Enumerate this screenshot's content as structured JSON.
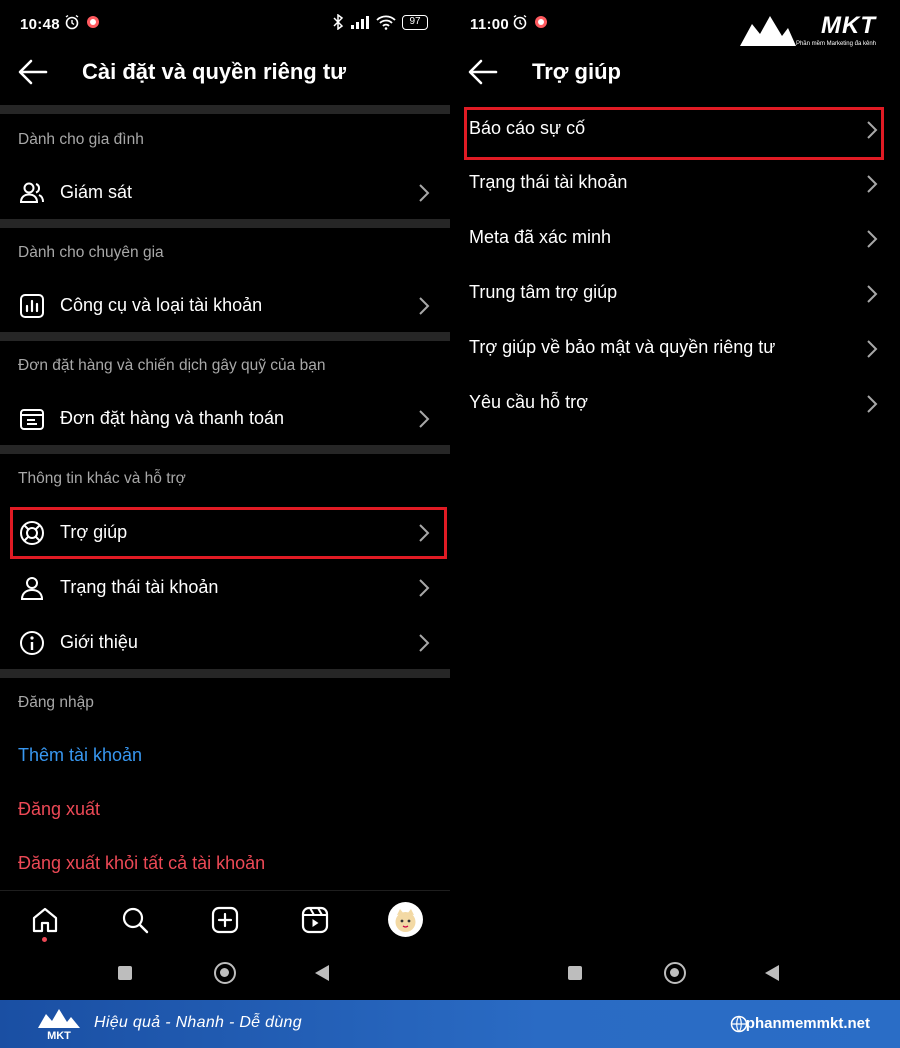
{
  "left": {
    "status": {
      "time": "10:48",
      "battery": "97"
    },
    "title": "Cài đặt và quyền riêng tư",
    "sections": {
      "family": {
        "header": "Dành cho gia đình",
        "items": [
          "Giám sát"
        ]
      },
      "pro": {
        "header": "Dành cho chuyên gia",
        "items": [
          "Công cụ và loại tài khoản"
        ]
      },
      "orders": {
        "header": "Đơn đặt hàng và chiến dịch gây quỹ của bạn",
        "items": [
          "Đơn đặt hàng và thanh toán"
        ]
      },
      "more": {
        "header": "Thông tin khác và hỗ trợ",
        "items": [
          "Trợ giúp",
          "Trạng thái tài khoản",
          "Giới thiệu"
        ]
      },
      "login": {
        "header": "Đăng nhập",
        "add_account": "Thêm tài khoản",
        "logout": "Đăng xuất",
        "logout_all": "Đăng xuất khỏi tất cả tài khoản"
      }
    }
  },
  "right": {
    "status": {
      "time": "11:00"
    },
    "title": "Trợ giúp",
    "items": [
      "Báo cáo sự cố",
      "Trạng thái tài khoản",
      "Meta đã xác minh",
      "Trung tâm trợ giúp",
      "Trợ giúp về bảo mật và quyền riêng tư",
      "Yêu cầu hỗ trợ"
    ]
  },
  "branding": {
    "logo_name": "MKT",
    "logo_sub": "Phần mềm Marketing đa kênh",
    "tagline": "Hiệu quả - Nhanh - Dễ dùng",
    "website": "phanmemmkt.net"
  },
  "colors": {
    "background": "#000000",
    "separator": "#262626",
    "secondary_text": "#a8a8a8",
    "link_blue": "#3897f0",
    "danger_red": "#ed4956",
    "highlight_red": "#e01b24",
    "footer_blue": "#2a6bc4"
  }
}
